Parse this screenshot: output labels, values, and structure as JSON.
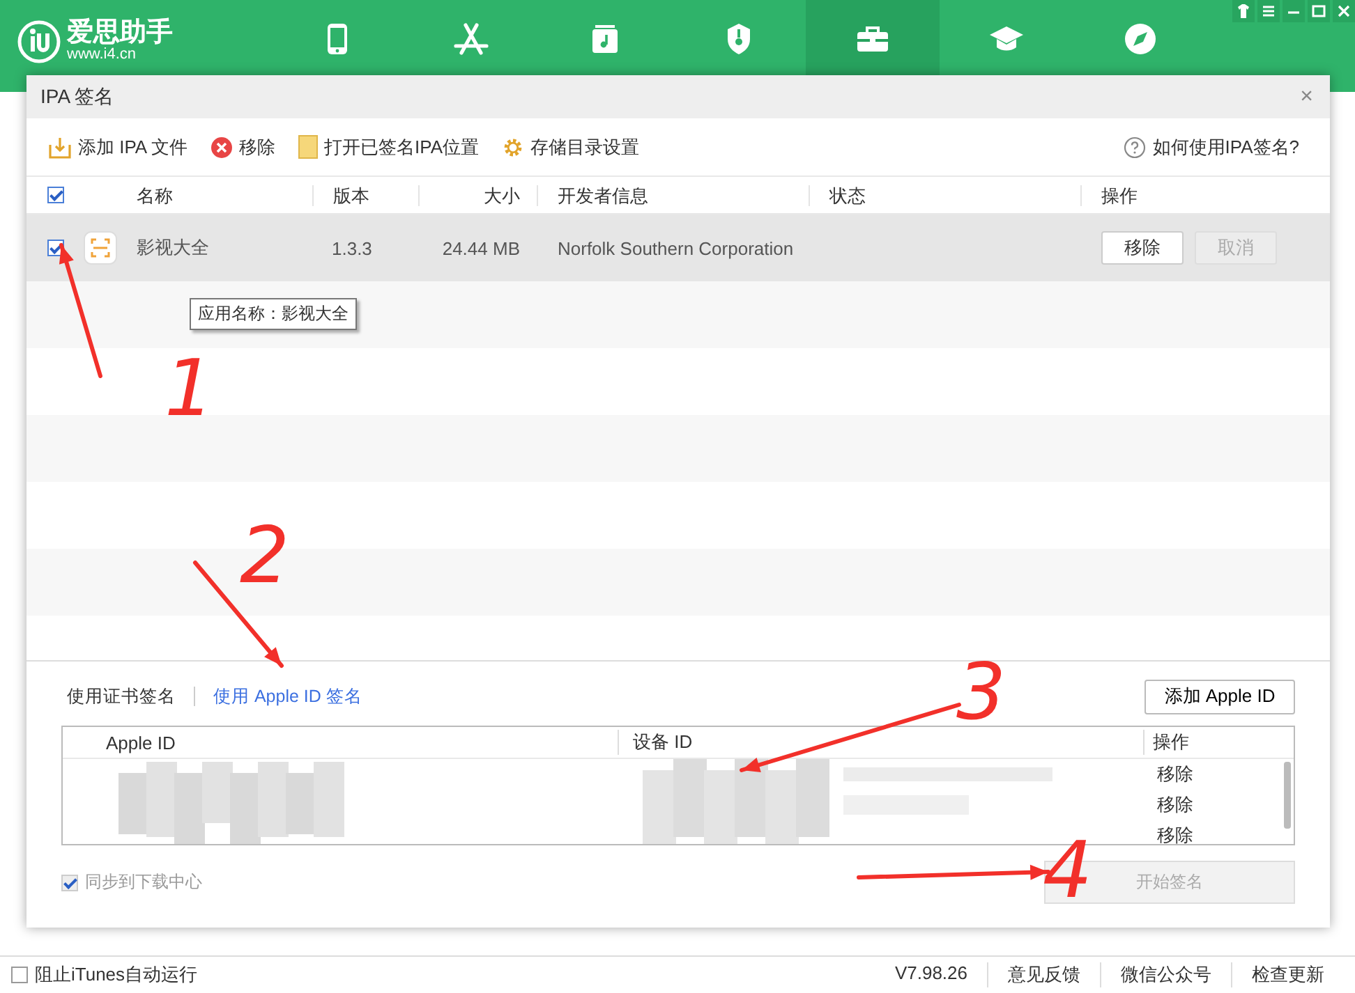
{
  "app": {
    "logo_name": "爱思助手",
    "logo_url": "www.i4.cn",
    "nav": [
      {
        "kind": "phone",
        "selected": false
      },
      {
        "kind": "apps",
        "selected": false
      },
      {
        "kind": "music",
        "selected": false
      },
      {
        "kind": "shield",
        "selected": false
      },
      {
        "kind": "toolbox",
        "selected": true
      },
      {
        "kind": "cap",
        "selected": false
      },
      {
        "kind": "compass",
        "selected": false
      }
    ]
  },
  "dialog": {
    "title": "IPA 签名",
    "close": "×",
    "toolbar": [
      {
        "kind": "add",
        "label": "添加 IPA 文件"
      },
      {
        "kind": "remove",
        "label": "移除"
      },
      {
        "kind": "folder",
        "label": "打开已签名IPA位置"
      },
      {
        "kind": "gear",
        "label": "存储目录设置"
      }
    ],
    "help": "如何使用IPA签名?",
    "header_checked": true,
    "columns": [
      "名称",
      "版本",
      "大小",
      "开发者信息",
      "状态",
      "操作"
    ],
    "rows": [
      {
        "checked": true,
        "selected": true,
        "name": "影视大全",
        "version": "1.3.3",
        "size": "24.44 MB",
        "developer": "Norfolk Southern Corporation",
        "actions": [
          {
            "label": "移除",
            "disabled": false
          },
          {
            "label": "取消",
            "disabled": true
          }
        ]
      }
    ],
    "tooltip": "应用名称：影视大全",
    "sign_tabs": [
      {
        "label": "使用证书签名",
        "selected": false
      },
      {
        "label": "使用 Apple ID 签名",
        "selected": true
      }
    ],
    "add_apple_id": "添加 Apple ID",
    "id_columns": [
      "Apple ID",
      "设备 ID",
      "操作"
    ],
    "id_rows": [
      {
        "action": "移除"
      },
      {
        "action": "移除"
      },
      {
        "action": "移除"
      }
    ],
    "sync": {
      "label": "同步到下载中心",
      "checked": true,
      "disabled": true
    },
    "start": {
      "label": "开始签名",
      "disabled": true
    }
  },
  "status_bar": {
    "itunes": {
      "label": "阻止iTunes自动运行",
      "checked": false
    },
    "items": [
      "V7.98.26",
      "意见反馈",
      "微信公众号",
      "检查更新"
    ]
  },
  "annotations": [
    {
      "label": "1"
    },
    {
      "label": "2"
    },
    {
      "label": "3"
    },
    {
      "label": "4"
    }
  ]
}
